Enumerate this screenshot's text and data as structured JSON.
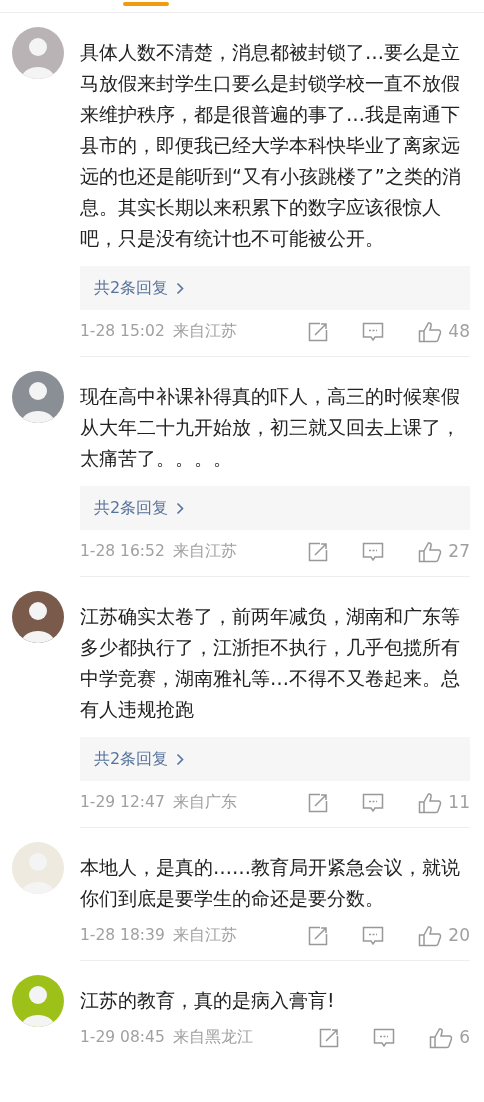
{
  "comments": [
    {
      "text": "具体人数不清楚，消息都被封锁了…要么是立马放假来封学生口要么是封锁学校一直不放假来维护秩序，都是很普遍的事了…我是南通下县市的，即便我已经大学本科快毕业了离家远远的也还是能听到“又有小孩跳楼了”之类的消息。其实长期以来积累下的数字应该很惊人吧，只是没有统计也不可能被公开。",
      "replies": "共2条回复",
      "time": "1-28 15:02",
      "location": "来自江苏",
      "likes": "48"
    },
    {
      "text": "现在高中补课补得真的吓人，高三的时候寒假从大年二十九开始放，初三就又回去上课了，太痛苦了。。。。",
      "replies": "共2条回复",
      "time": "1-28 16:52",
      "location": "来自江苏",
      "likes": "27"
    },
    {
      "text": "江苏确实太卷了，前两年减负，湖南和广东等多少都执行了，江浙拒不执行，几乎包揽所有中学竞赛，湖南雅礼等…不得不又卷起来。总有人违规抢跑",
      "replies": "共2条回复",
      "time": "1-29 12:47",
      "location": "来自广东",
      "likes": "11"
    },
    {
      "text": "本地人，是真的……教育局开紧急会议，就说你们到底是要学生的命还是要分数。",
      "time": "1-28 18:39",
      "location": "来自江苏",
      "likes": "20"
    },
    {
      "text": "江苏的教育，真的是病入膏肓!",
      "time": "1-29 08:45",
      "location": "来自黑龙江",
      "likes": "6"
    }
  ]
}
